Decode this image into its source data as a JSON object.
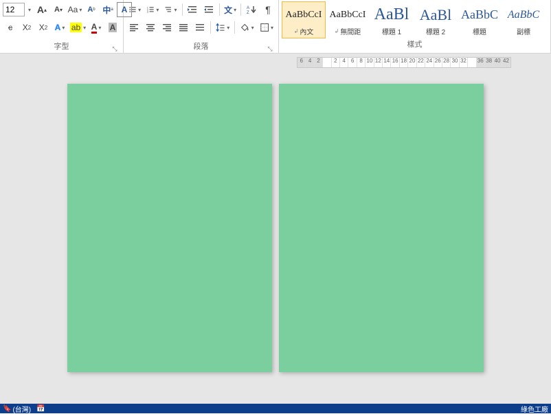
{
  "font": {
    "size": "12",
    "group_label": "字型"
  },
  "para": {
    "group_label": "段落"
  },
  "styles": {
    "group_label": "樣式",
    "items": [
      {
        "preview": "AaBbCcI",
        "name": "內文",
        "psize": "14",
        "link": true,
        "sel": true
      },
      {
        "preview": "AaBbCcI",
        "name": "無間距",
        "psize": "14",
        "link": true,
        "sel": false
      },
      {
        "preview": "AaBl",
        "name": "標題 1",
        "psize": "24",
        "link": false,
        "sel": false
      },
      {
        "preview": "AaBl",
        "name": "標題 2",
        "psize": "22",
        "link": false,
        "sel": false
      },
      {
        "preview": "AaBbC",
        "name": "標題",
        "psize": "18",
        "link": false,
        "sel": false
      },
      {
        "preview": "AaBbC",
        "name": "副標",
        "psize": "16",
        "link": false,
        "sel": false,
        "italic": true
      }
    ]
  },
  "ruler": {
    "left_margin": [
      "6",
      "4",
      "2"
    ],
    "mid": [
      "2",
      "4",
      "6",
      "8",
      "10",
      "12",
      "14",
      "16",
      "18",
      "20",
      "22",
      "24",
      "26",
      "28",
      "30",
      "32"
    ],
    "right_margin": [
      "36",
      "38",
      "40",
      "42"
    ]
  },
  "status": {
    "lang": "(台灣)",
    "brand": "綠色工廠"
  }
}
